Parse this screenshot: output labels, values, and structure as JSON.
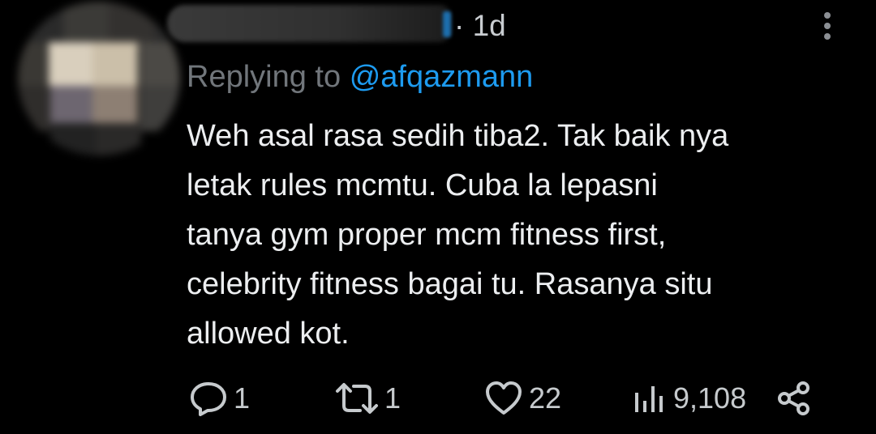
{
  "tweet": {
    "time": "· 1d",
    "reply_prefix": "Replying to",
    "reply_handle": "@afqazmann",
    "body_lines": [
      "Weh asal rasa sedih tiba2. Tak baik nya",
      "letak rules mcmtu. Cuba la lepasni",
      "tanya gym proper mcm fitness first,",
      "celebrity fitness bagai tu. Rasanya situ",
      "allowed kot."
    ]
  },
  "actions": {
    "replies": "1",
    "reposts": "1",
    "likes": "22",
    "views": "9,108"
  },
  "icons": {
    "reply": "reply-icon",
    "repost": "repost-icon",
    "like": "heart-icon",
    "views": "views-icon",
    "share": "share-icon",
    "more": "more-options-icon"
  },
  "colors": {
    "background": "#000000",
    "text": "#e7e9ea",
    "muted": "#71767b",
    "link": "#1d9bf0"
  }
}
